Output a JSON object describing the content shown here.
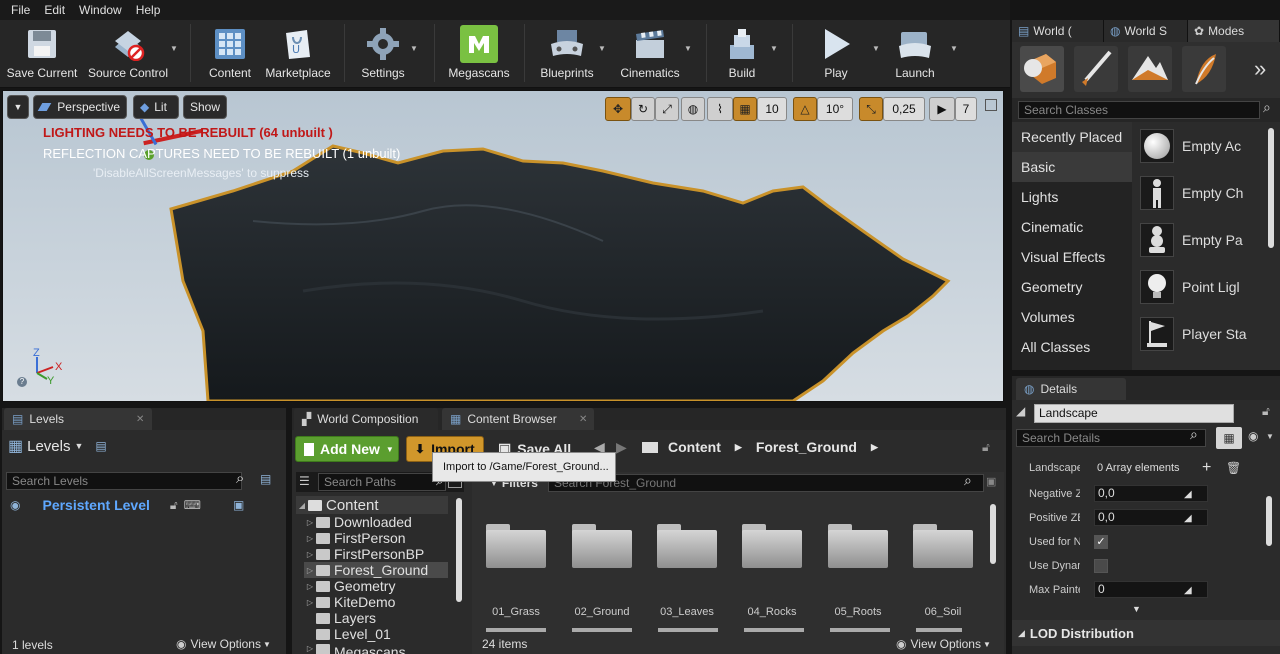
{
  "menu": [
    "File",
    "Edit",
    "Window",
    "Help"
  ],
  "toolbar": {
    "save_current": "Save Current",
    "source_control": "Source Control",
    "content": "Content",
    "marketplace": "Marketplace",
    "settings": "Settings",
    "megascans": "Megascans",
    "blueprints": "Blueprints",
    "cinematics": "Cinematics",
    "build": "Build",
    "play": "Play",
    "launch": "Launch"
  },
  "right_tabs": [
    "World (",
    "World S",
    "Modes"
  ],
  "modes": {
    "search_placeholder": "Search Classes",
    "categories": [
      "Recently Placed",
      "Basic",
      "Lights",
      "Cinematic",
      "Visual Effects",
      "Geometry",
      "Volumes",
      "All Classes"
    ],
    "selected_category": "Basic",
    "classes": [
      "Empty Ac",
      "Empty Ch",
      "Empty Pa",
      "Point Ligl",
      "Player Sta"
    ]
  },
  "viewport": {
    "perspective": "Perspective",
    "lit": "Lit",
    "show": "Show",
    "grid_snap": "10",
    "rotation_snap": "10°",
    "scale_snap": "0,25",
    "camera_speed": "7",
    "msg_lighting": "LIGHTING NEEDS TO BE REBUILT (64 unbuilt )",
    "msg_reflection": "REFLECTION CAPTURES NEED TO BE REBUILT (1 unbuilt)",
    "msg_disable": "'DisableAllScreenMessages' to suppress",
    "axis_z": "Z",
    "axis_x": "X",
    "axis_y": "Y"
  },
  "levels_panel": {
    "tab": "Levels",
    "title": "Levels",
    "search_placeholder": "Search Levels",
    "persistent_level": "Persistent Level",
    "count": "1 levels",
    "view_options": "View Options"
  },
  "content_browser": {
    "tab_world_composition": "World Composition",
    "tab_content_browser": "Content Browser",
    "add_new": "Add New",
    "import": "Import",
    "save_all": "Save All",
    "breadcrumb": [
      "Content",
      "Forest_Ground"
    ],
    "tooltip": "Import to /Game/Forest_Ground...",
    "search_paths": "Search Paths",
    "filters": "Filters",
    "search_value": "Search Forest_Ground",
    "tree": [
      "Content",
      "Downloaded",
      "FirstPerson",
      "FirstPersonBP",
      "Forest_Ground",
      "Geometry",
      "KiteDemo",
      "Layers",
      "Level_01",
      "Megascans"
    ],
    "folders": [
      "01_Grass",
      "02_Ground",
      "03_Leaves",
      "04_Rocks",
      "05_Roots",
      "06_Soil"
    ],
    "item_count": "24 items",
    "view_options": "View Options"
  },
  "details": {
    "tab": "Details",
    "name": "Landscape",
    "search_placeholder": "Search Details",
    "rows": [
      {
        "label": "Landscape M",
        "value": "0 Array elements"
      },
      {
        "label": "Negative ZBo",
        "value": "0,0"
      },
      {
        "label": "Positive ZBo",
        "value": "0,0"
      },
      {
        "label": "Used for Nav",
        "value": "checked"
      },
      {
        "label": "Use Dynamic",
        "value": "unchecked"
      },
      {
        "label": "Max Painted",
        "value": "0"
      }
    ],
    "section": "LOD Distribution"
  }
}
